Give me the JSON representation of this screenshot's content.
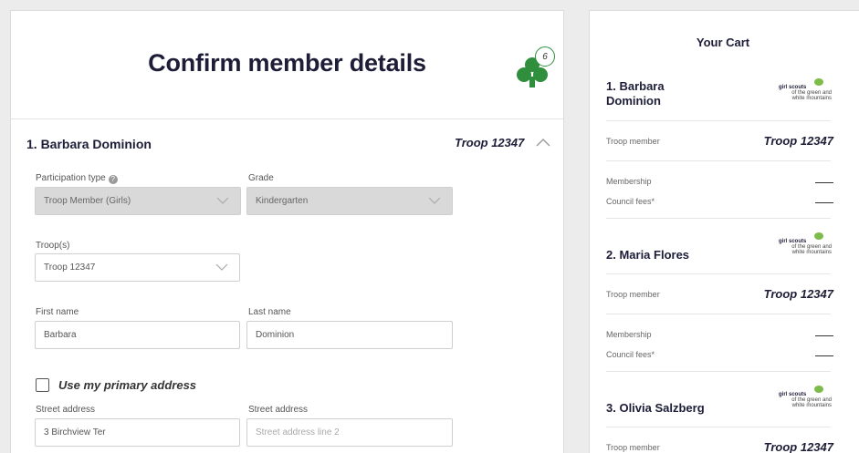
{
  "header": {
    "title": "Confirm member details",
    "badge_count": "6"
  },
  "member": {
    "heading": "1. Barbara Dominion",
    "troop": "Troop 12347"
  },
  "form": {
    "participation_label": "Participation type",
    "participation_value": "Troop Member (Girls)",
    "grade_label": "Grade",
    "grade_value": "Kindergarten",
    "troops_label": "Troop(s)",
    "troops_value": "Troop 12347",
    "first_name_label": "First name",
    "first_name_value": "Barbara",
    "last_name_label": "Last name",
    "last_name_value": "Dominion",
    "primary_address_label": "Use my primary address",
    "street_label": "Street address",
    "street_value": "3 Birchview Ter",
    "street2_label": "Street address",
    "street2_placeholder": "Street address line 2"
  },
  "cart": {
    "title": "Your Cart",
    "logo_line1": "girl scouts",
    "logo_line2": "of the green and",
    "logo_line3": "white mountains",
    "troop_member_label": "Troop member",
    "membership_label": "Membership",
    "council_fees_label": "Council fees*",
    "members": [
      {
        "name_line1": "1. Barbara",
        "name_line2": "Dominion",
        "troop": "Troop 12347"
      },
      {
        "name_line1": "2. Maria Flores",
        "troop": "Troop 12347"
      },
      {
        "name_line1": "3. Olivia Salzberg",
        "troop": "Troop 12347"
      }
    ]
  },
  "colors": {
    "brand_green": "#2f8f3c",
    "navy": "#1d1d38"
  },
  "icons": {
    "trefoil": "trefoil-icon",
    "chevron_up": "chevron-up-icon",
    "chevron_down": "chevron-down-icon",
    "help": "help-icon"
  }
}
